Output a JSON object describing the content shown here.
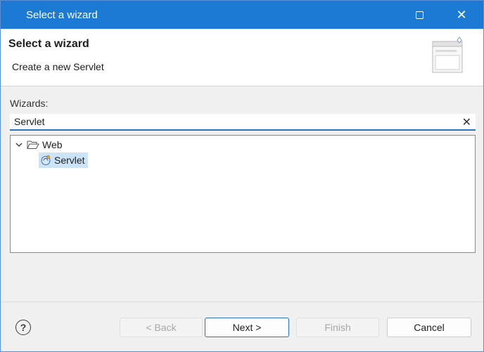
{
  "window": {
    "title": "Select a wizard",
    "maximize_icon": "maximize-icon",
    "close_glyph": "✕"
  },
  "header": {
    "title": "Select a wizard",
    "subtitle": "Create a new Servlet",
    "banner_icon": "wizard-banner-icon"
  },
  "wizards": {
    "label": "Wizards:",
    "filter_value": "Servlet",
    "clear_glyph": "✕"
  },
  "tree": {
    "items": [
      {
        "label": "Web",
        "icon": "folder-open-icon",
        "expanded": true
      },
      {
        "label": "Servlet",
        "icon": "servlet-icon",
        "selected": true
      }
    ]
  },
  "footer": {
    "help_glyph": "?",
    "back_label": "< Back",
    "next_label": "Next >",
    "finish_label": "Finish",
    "cancel_label": "Cancel"
  },
  "colors": {
    "titlebar": "#1c7ad4",
    "selection": "#cce4f7",
    "focus": "#2b73c6"
  }
}
